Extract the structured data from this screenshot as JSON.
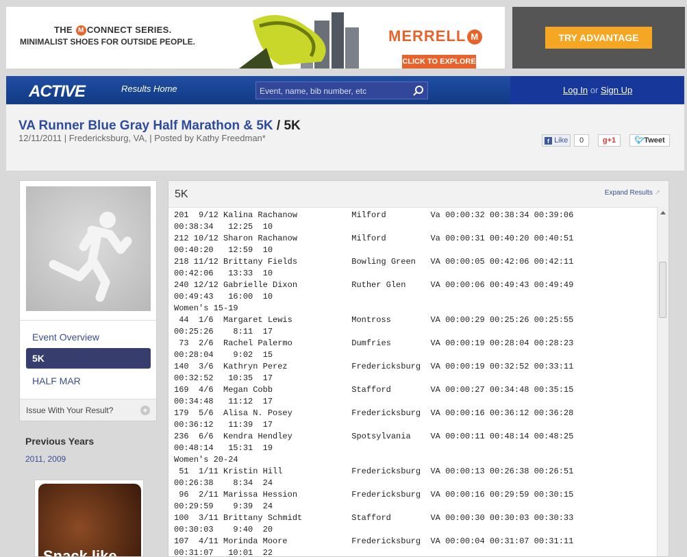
{
  "ad": {
    "line1_pre": "THE",
    "line1_logo": "M",
    "line1_brand": "CONNECT",
    "line1_post": " SERIES.",
    "line2": "MINIMALIST SHOES FOR OUTSIDE PEOPLE.",
    "brand": "MERRELL",
    "brand_mark": "M",
    "cta": "CLICK TO EXPLORE",
    "side_cta": "TRY ADVANTAGE"
  },
  "nav": {
    "logo": "ACTIVE",
    "results_home": "Results Home",
    "search_placeholder": "Event, name, bib number, etc",
    "login": "Log In",
    "or": "or",
    "signup": "Sign Up"
  },
  "header": {
    "event": "VA Runner Blue Gray Half Marathon & 5K",
    "sep": "/",
    "race": "5K",
    "subtitle": "12/11/2011 | Fredericksburg, VA, | Posted by Kathy Freedman*",
    "like": "Like",
    "like_count": "0",
    "plusone": "+1",
    "tweet": "Tweet"
  },
  "sidebar": {
    "items": [
      "Event Overview",
      "5K",
      "HALF MAR"
    ],
    "issue": "Issue With Your Result?",
    "prev_title": "Previous Years",
    "prev_years": "2011, 2009",
    "ad_text": "Snack like"
  },
  "panel": {
    "title": "5K",
    "expand": "Expand Results",
    "lines": [
      "201  9/12 Kalina Rachanow           Milford         Va 00:00:32 00:38:34 00:39:06",
      "00:38:34   12:25  10",
      "212 10/12 Sharon Rachanow           Milford         Va 00:00:31 00:40:20 00:40:51",
      "00:40:20   12:59  10",
      "218 11/12 Brittany Fields           Bowling Green   VA 00:00:05 00:42:06 00:42:11",
      "00:42:06   13:33  10",
      "240 12/12 Gabrielle Dixon           Ruther Glen     VA 00:00:06 00:49:43 00:49:49",
      "00:49:43   16:00  10",
      "Women's 15-19",
      " 44  1/6  Margaret Lewis            Montross        VA 00:00:29 00:25:26 00:25:55",
      "00:25:26    8:11  17",
      " 73  2/6  Rachel Palermo            Dumfries        VA 00:00:19 00:28:04 00:28:23",
      "00:28:04    9:02  15",
      "140  3/6  Kathryn Perez             Fredericksburg  VA 00:00:19 00:32:52 00:33:11",
      "00:32:52   10:35  17",
      "169  4/6  Megan Cobb                Stafford        VA 00:00:27 00:34:48 00:35:15",
      "00:34:48   11:12  17",
      "179  5/6  Alisa N. Posey            Fredericksburg  VA 00:00:16 00:36:12 00:36:28",
      "00:36:12   11:39  17",
      "236  6/6  Kendra Hendley            Spotsylvania    VA 00:00:11 00:48:14 00:48:25",
      "00:48:14   15:31  19",
      "Women's 20-24",
      " 51  1/11 Kristin Hill              Fredericksburg  VA 00:00:13 00:26:38 00:26:51",
      "00:26:38    8:34  24",
      " 96  2/11 Marissa Hession           Fredericksburg  VA 00:00:16 00:29:59 00:30:15",
      "00:29:59    9:39  24",
      "100  3/11 Brittany Schmidt          Stafford        VA 00:00:30 00:30:03 00:30:33",
      "00:30:03    9:40  20",
      "107  4/11 Morinda Moore             Fredericksburg  VA 00:00:04 00:31:07 00:31:11",
      "00:31:07   10:01  22"
    ]
  }
}
